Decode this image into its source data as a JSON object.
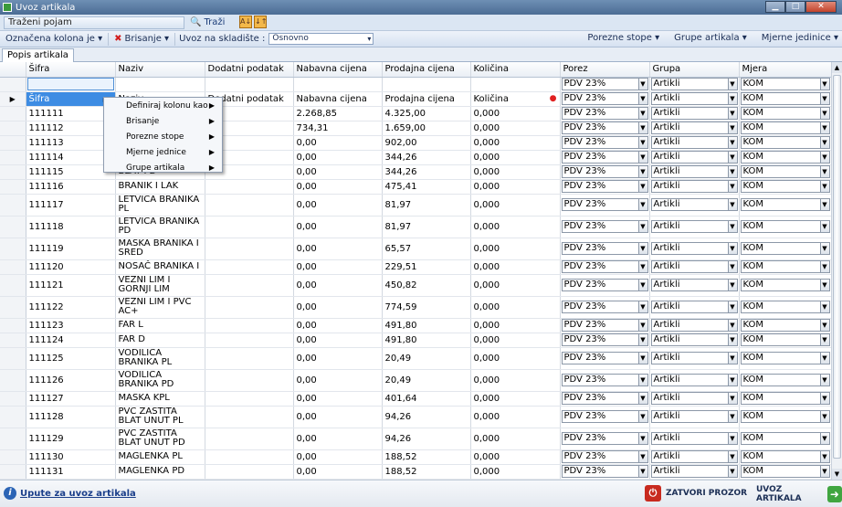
{
  "window": {
    "title": "Uvoz artikala",
    "minimize": "▁",
    "maximize": "□",
    "close": "✕"
  },
  "search": {
    "label": "Traženi pojam",
    "button": "Traži",
    "sort_asc": "A↓",
    "sort_desc": "↓↑"
  },
  "toolbar": {
    "marked_column": "Označena kolona je",
    "delete": "Brisanje",
    "warehouse_label": "Uvoz na skladište :",
    "warehouse_value": "Osnovno",
    "tax_rates": "Porezne stope",
    "item_groups": "Grupe artikala",
    "units": "Mjerne jedinice"
  },
  "tab": {
    "label": "Popis artikala"
  },
  "columns": [
    "Šifra",
    "Naziv",
    "Dodatni podatak",
    "Nabavna cijena",
    "Prodajna cijena",
    "Količina",
    "Porez",
    "Grupa",
    "Mjera"
  ],
  "header_row": {
    "sifra": "Šifra",
    "naziv": "Naziv",
    "dodatni": "Dodatni podatak",
    "nabavna": "Nabavna cijena",
    "prodajna": "Prodajna cijena",
    "kolicina": "Količina",
    "porez": "PDV 23%",
    "grupa": "Artikli",
    "mjera": "KOM"
  },
  "defaults": {
    "porez": "PDV 23%",
    "grupa": "Artikli",
    "mjera": "KOM"
  },
  "rows": [
    {
      "sifra": "111111",
      "naziv": "",
      "nabavna": "2.268,85",
      "prodajna": "4.325,00",
      "kolicina": "0,000"
    },
    {
      "sifra": "111112",
      "naziv": "",
      "nabavna": "734,31",
      "prodajna": "1.659,00",
      "kolicina": "0,000"
    },
    {
      "sifra": "111113",
      "naziv": "",
      "nabavna": "0,00",
      "prodajna": "902,00",
      "kolicina": "0,000"
    },
    {
      "sifra": "111114",
      "naziv": "",
      "nabavna": "0,00",
      "prodajna": "344,26",
      "kolicina": "0,000"
    },
    {
      "sifra": "111115",
      "naziv": "BLAT PD",
      "nabavna": "0,00",
      "prodajna": "344,26",
      "kolicina": "0,000"
    },
    {
      "sifra": "111116",
      "naziv": "BRANIK I LAK",
      "nabavna": "0,00",
      "prodajna": "475,41",
      "kolicina": "0,000"
    },
    {
      "sifra": "111117",
      "naziv": "LETVICA BRANIKA PL",
      "nabavna": "0,00",
      "prodajna": "81,97",
      "kolicina": "0,000"
    },
    {
      "sifra": "111118",
      "naziv": "LETVICA BRANIKA PD",
      "nabavna": "0,00",
      "prodajna": "81,97",
      "kolicina": "0,000"
    },
    {
      "sifra": "111119",
      "naziv": "MASKA BRANIKA I SRED",
      "nabavna": "0,00",
      "prodajna": "65,57",
      "kolicina": "0,000"
    },
    {
      "sifra": "111120",
      "naziv": "NOSAČ BRANIKA I",
      "nabavna": "0,00",
      "prodajna": "229,51",
      "kolicina": "0,000"
    },
    {
      "sifra": "111121",
      "naziv": "VEZNI LIM I GORNJI LIM",
      "nabavna": "0,00",
      "prodajna": "450,82",
      "kolicina": "0,000"
    },
    {
      "sifra": "111122",
      "naziv": "VEZNI LIM I PVC AC+",
      "nabavna": "0,00",
      "prodajna": "774,59",
      "kolicina": "0,000"
    },
    {
      "sifra": "111123",
      "naziv": "FAR L",
      "nabavna": "0,00",
      "prodajna": "491,80",
      "kolicina": "0,000"
    },
    {
      "sifra": "111124",
      "naziv": "FAR D",
      "nabavna": "0,00",
      "prodajna": "491,80",
      "kolicina": "0,000"
    },
    {
      "sifra": "111125",
      "naziv": "VODILICA BRANIKA PL",
      "nabavna": "0,00",
      "prodajna": "20,49",
      "kolicina": "0,000"
    },
    {
      "sifra": "111126",
      "naziv": "VODILICA BRANIKA PD",
      "nabavna": "0,00",
      "prodajna": "20,49",
      "kolicina": "0,000"
    },
    {
      "sifra": "111127",
      "naziv": "MASKA KPL",
      "nabavna": "0,00",
      "prodajna": "401,64",
      "kolicina": "0,000"
    },
    {
      "sifra": "111128",
      "naziv": "PVC ZAŠTITA BLAT UNUT PL",
      "nabavna": "0,00",
      "prodajna": "94,26",
      "kolicina": "0,000"
    },
    {
      "sifra": "111129",
      "naziv": "PVC ZAŠTITA BLAT UNUT PD",
      "nabavna": "0,00",
      "prodajna": "94,26",
      "kolicina": "0,000"
    },
    {
      "sifra": "111130",
      "naziv": "MAGLENKA PL",
      "nabavna": "0,00",
      "prodajna": "188,52",
      "kolicina": "0,000"
    },
    {
      "sifra": "111131",
      "naziv": "MAGLENKA PD",
      "nabavna": "0,00",
      "prodajna": "188,52",
      "kolicina": "0,000"
    }
  ],
  "context_menu": [
    "Definiraj kolonu kao",
    "Brisanje",
    "Porezne stope",
    "Mjerne jednice",
    "Grupe artikala"
  ],
  "footer": {
    "help_link": "Upute za uvoz artikala",
    "close_button": "ZATVORI PROZOR",
    "import_button": "UVOZ ARTIKALA"
  }
}
